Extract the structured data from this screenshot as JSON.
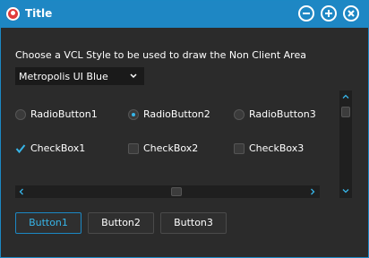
{
  "window": {
    "title": "Title"
  },
  "caption_buttons": [
    "minimize-icon",
    "maximize-icon",
    "close-icon"
  ],
  "colors": {
    "accent": "#1e87c4",
    "background": "#2b2b2b",
    "focus_text": "#37b5e8"
  },
  "style_section": {
    "label": "Choose a VCL Style to be used to draw the Non Client Area",
    "combo_value": "Metropolis UI Blue"
  },
  "radios": [
    {
      "label": "RadioButton1",
      "checked": false
    },
    {
      "label": "RadioButton2",
      "checked": true
    },
    {
      "label": "RadioButton3",
      "checked": false
    }
  ],
  "checkboxes": [
    {
      "label": "CheckBox1",
      "checked": true
    },
    {
      "label": "CheckBox2",
      "checked": false
    },
    {
      "label": "CheckBox3",
      "checked": false
    }
  ],
  "buttons": [
    {
      "label": "Button1",
      "focused": true
    },
    {
      "label": "Button2",
      "focused": false
    },
    {
      "label": "Button3",
      "focused": false
    }
  ]
}
